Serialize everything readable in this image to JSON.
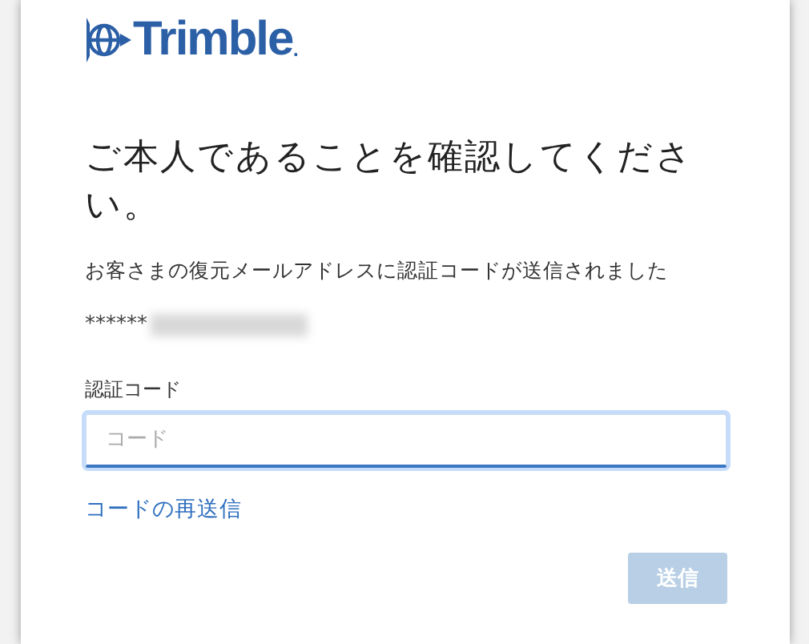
{
  "logo": {
    "text": "Trimble",
    "mark": "."
  },
  "heading": "ご本人であることを確認してください。",
  "message": "お客さまの復元メールアドレスに認証コードが送信されました",
  "masked_email": "******",
  "code_field": {
    "label": "認証コード",
    "placeholder": "コード",
    "focused": true
  },
  "resend_link": "コードの再送信",
  "submit_button": {
    "label": "送信",
    "disabled": true
  }
}
